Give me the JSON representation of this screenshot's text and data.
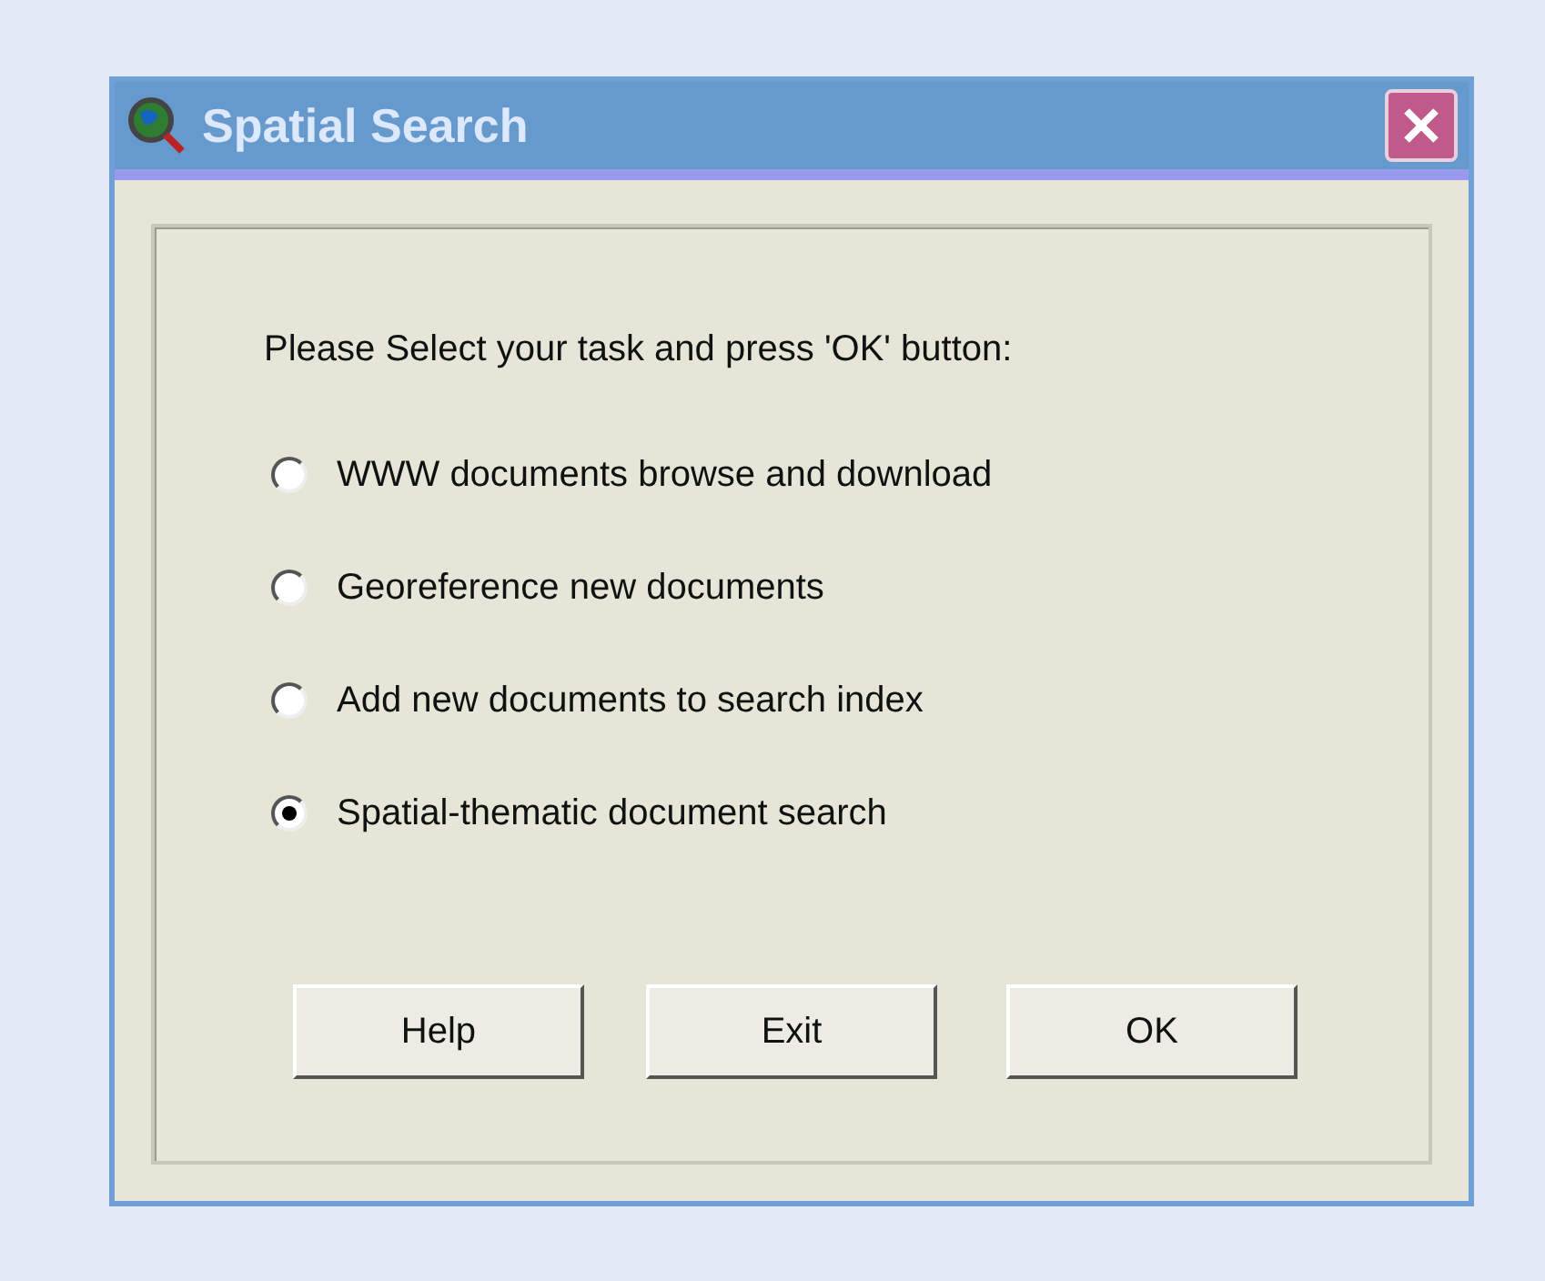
{
  "window": {
    "title": "Spatial Search"
  },
  "prompt": "Please Select your task and press 'OK' button:",
  "options": [
    {
      "label": "WWW documents browse and download",
      "selected": false
    },
    {
      "label": "Georeference new documents",
      "selected": false
    },
    {
      "label": "Add new documents to search index",
      "selected": false
    },
    {
      "label": "Spatial-thematic document search",
      "selected": true
    }
  ],
  "buttons": [
    "Help",
    "Exit",
    "OK"
  ]
}
